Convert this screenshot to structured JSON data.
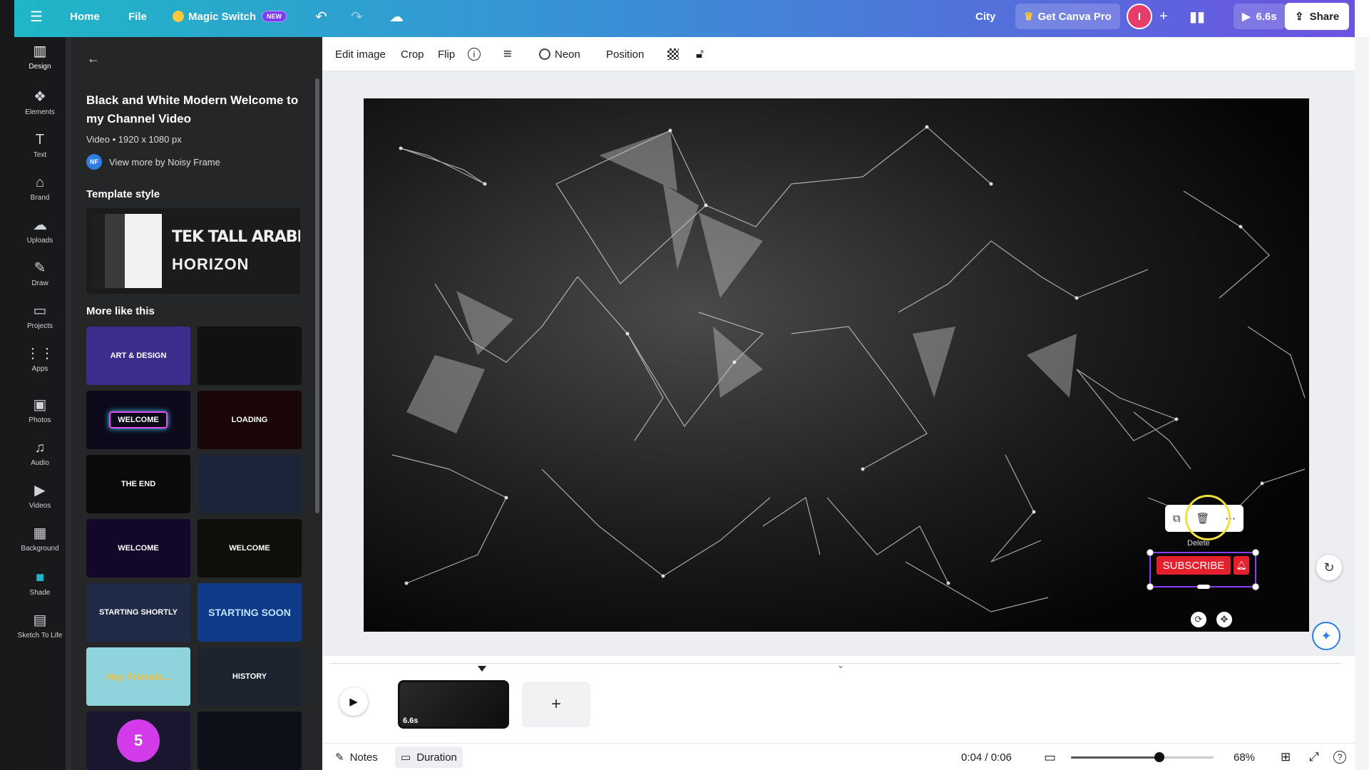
{
  "topbar": {
    "home": "Home",
    "file": "File",
    "magic_switch": "Magic Switch",
    "new_badge": "NEW",
    "project_name": "City",
    "get_pro": "Get Canva Pro",
    "avatar_letter": "I",
    "play_duration": "6.6s",
    "share": "Share"
  },
  "rail": [
    {
      "label": "Design",
      "icon": "design-icon"
    },
    {
      "label": "Elements",
      "icon": "elements-icon"
    },
    {
      "label": "Text",
      "icon": "text-icon"
    },
    {
      "label": "Brand",
      "icon": "brand-icon"
    },
    {
      "label": "Uploads",
      "icon": "uploads-icon"
    },
    {
      "label": "Draw",
      "icon": "draw-icon"
    },
    {
      "label": "Projects",
      "icon": "projects-icon"
    },
    {
      "label": "Apps",
      "icon": "apps-icon"
    },
    {
      "label": "Photos",
      "icon": "photos-icon"
    },
    {
      "label": "Audio",
      "icon": "audio-icon"
    },
    {
      "label": "Videos",
      "icon": "videos-icon"
    },
    {
      "label": "Background",
      "icon": "background-icon"
    },
    {
      "label": "Shade",
      "icon": "shade-icon"
    },
    {
      "label": "Sketch To Life",
      "icon": "sketch-icon"
    }
  ],
  "panel": {
    "title": "Black and White Modern Welcome to my Channel Video",
    "meta": "Video • 1920 x 1080 px",
    "author_initials": "NF",
    "author_link": "View more by Noisy Frame",
    "template_style_heading": "Template style",
    "style_font_1": "TEK TALL ARABIC C",
    "style_font_2": "HORIZON",
    "more_heading": "More like this",
    "thumbs": [
      {
        "label": "ART & DESIGN",
        "bg": "#3a2d8c"
      },
      {
        "label": "",
        "bg": "#111111"
      },
      {
        "label": "WELCOME",
        "bg": "#0c0a1a"
      },
      {
        "label": "LOADING",
        "bg": "#1a0608"
      },
      {
        "label": "THE END",
        "bg": "#0a0a0c"
      },
      {
        "label": "",
        "bg": "#1b2438"
      },
      {
        "label": "WELCOME",
        "bg": "#14082a"
      },
      {
        "label": "WELCOME",
        "bg": "#100e0a"
      },
      {
        "label": "STARTING SHORTLY",
        "bg": "#1e2a46"
      },
      {
        "label": "STARTING SOON",
        "bg": "#0f3a8a"
      },
      {
        "label": "Hey Friends...",
        "bg": "#8fd3dc"
      },
      {
        "label": "HISTORY",
        "bg": "#1c2430"
      },
      {
        "label": "5",
        "bg": "#1a1630"
      },
      {
        "label": "",
        "bg": "#0d1018"
      }
    ]
  },
  "toolbar": {
    "edit_image": "Edit image",
    "crop": "Crop",
    "flip": "Flip",
    "neon": "Neon",
    "position": "Position"
  },
  "canvas": {
    "subscribe": "SUBSCRIBE",
    "delete_tooltip": "Delete"
  },
  "timeline": {
    "clip_duration": "6.6s",
    "add": "+"
  },
  "bottom": {
    "notes": "Notes",
    "duration": "Duration",
    "time": "0:04 / 0:06",
    "zoom": "68%",
    "zoom_level": 0.62
  },
  "colors": {
    "accent": "#8b3dff",
    "subscribe_red": "#e3202b"
  }
}
